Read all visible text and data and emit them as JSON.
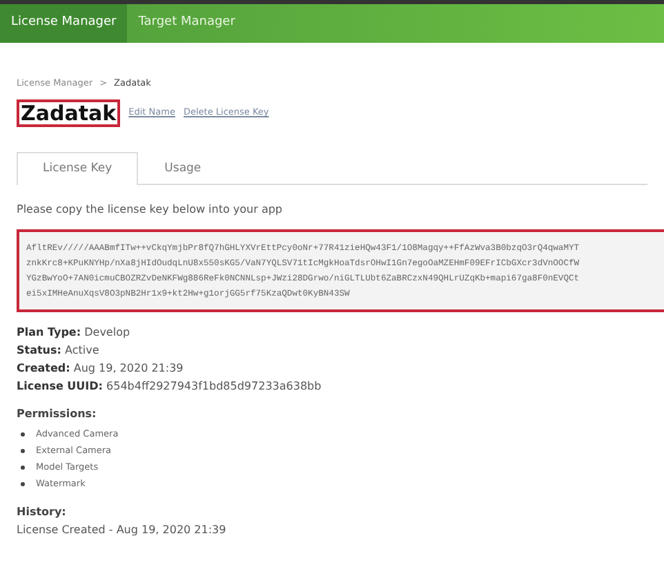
{
  "navbar": {
    "items": [
      {
        "label": "License Manager",
        "selected": true
      },
      {
        "label": "Target Manager",
        "selected": false
      }
    ]
  },
  "breadcrumb": {
    "items": [
      "License Manager",
      "Zadatak"
    ],
    "separator": ">"
  },
  "title": "Zadatak",
  "title_actions": [
    "Edit Name",
    "Delete License Key"
  ],
  "tabs": [
    {
      "label": "License Key",
      "selected": true
    },
    {
      "label": "Usage",
      "selected": false
    }
  ],
  "instruction": "Please copy the license key below into your app",
  "license_key": [
    "AfltREv/////AAABmfITw++vCkqYmjbPr8fQ7hGHLYXVrEttPcy0oNr+77R41zieHQw43F1/1O8Magqy++FfAzWva3B0bzqO3rQ4qwaMYT",
    "znkKrc8+KPuKNYHp/nXa8jHIdOudqLnU8x550sKG5/VaN7YQLSV71tIcMgkHoaTdsrOHwI1Gn7egoOaMZEHmF09EFrICbGXcr3dVnOOCfW",
    "YGzBwYoO+7AN0icmuCBOZRZvDeNKFWg886ReFk0NCNNLsp+JWzi28DGrwo/niGLTLUbt6ZaBRCzxN49QHLrUZqKb+mapi67ga8F0nEVQCt",
    "ei5xIMHeAnuXqsV8O3pNB2Hr1x9+kt2Hw+g1orjGG5rf75KzaQDwt0KyBN43SW"
  ],
  "details": [
    {
      "label": "Plan Type:",
      "value": "Develop"
    },
    {
      "label": "Status:",
      "value": "Active"
    },
    {
      "label": "Created:",
      "value": "Aug 19, 2020 21:39"
    },
    {
      "label": "License UUID:",
      "value": "654b4ff2927943f1bd85d97233a638bb"
    }
  ],
  "permissions": {
    "heading": "Permissions:",
    "items": [
      "Advanced Camera",
      "External Camera",
      "Model Targets",
      "Watermark"
    ]
  },
  "history": {
    "heading": "History:",
    "entries": [
      "License Created - Aug 19, 2020 21:39"
    ]
  }
}
